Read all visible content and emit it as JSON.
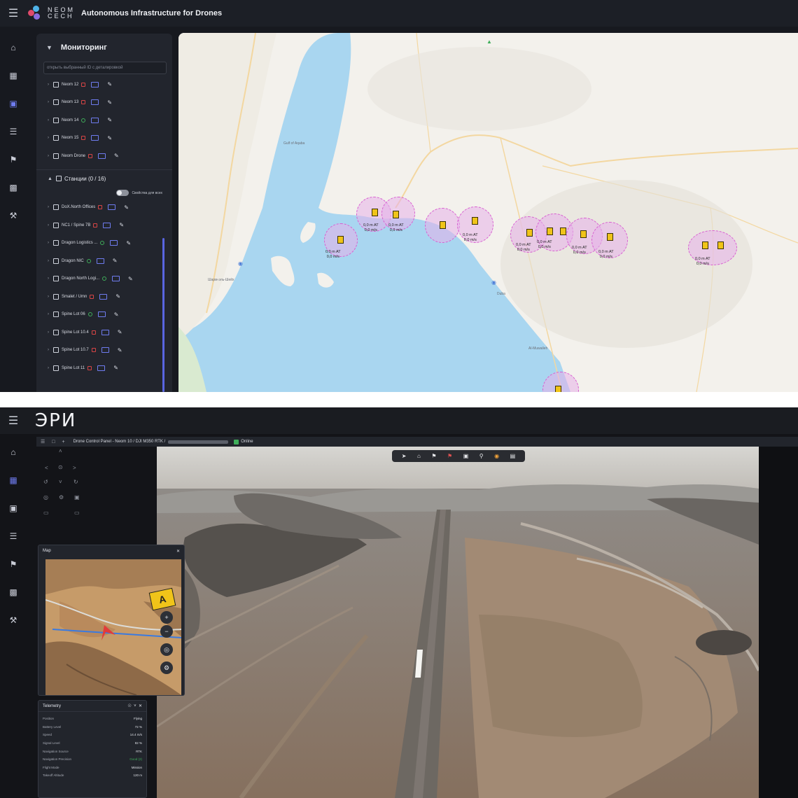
{
  "screen1": {
    "header": {
      "logo_text": "NEOM CECH",
      "app_title": "Autonomous Infrastructure for Drones"
    },
    "rail_icons": [
      "home-icon",
      "grid-icon",
      "monitor-icon",
      "list-icon",
      "flag-icon",
      "camera-icon",
      "wrench-icon"
    ],
    "rail_active": "monitor-icon",
    "panel": {
      "title": "Мониторинг",
      "search_placeholder": "открыть выбранный ID с деталировкой",
      "drones": [
        {
          "name": "Neom 12",
          "signal": "red"
        },
        {
          "name": "Neom 13",
          "signal": "red"
        },
        {
          "name": "Neom 14",
          "signal": "green"
        },
        {
          "name": "Neom 15",
          "signal": "red"
        },
        {
          "name": "Neom Drone",
          "signal": "red"
        }
      ],
      "stations_group": "Станции (0 / 16)",
      "toggle_label": "Свойства для всех",
      "stations": [
        {
          "name": "DoX.North Offices",
          "signal": "red"
        },
        {
          "name": "NC1 / Spine 7B",
          "signal": "red"
        },
        {
          "name": "Dragon Logistics ...",
          "signal": "green"
        },
        {
          "name": "Dragon NIC",
          "signal": "green"
        },
        {
          "name": "Dragon North Logi...",
          "signal": "green"
        },
        {
          "name": "Smalet / Umn",
          "signal": "red"
        },
        {
          "name": "Spine Lot 06",
          "signal": "green"
        },
        {
          "name": "Spine Lot 10.4",
          "signal": "red"
        },
        {
          "name": "Spine Lot 10.7",
          "signal": "red"
        },
        {
          "name": "Spine Lot 11",
          "signal": "red"
        }
      ]
    },
    "map": {
      "place_labels": [
        "Шарм-эль-Шейх",
        "Gulf of Aqaba",
        "Al-Muwaileh",
        "Duba"
      ],
      "station_labels": [
        {
          "l1": "0,0 m AT",
          "l2": "0,0 m/s"
        },
        {
          "l1": "0,0 m AT",
          "l2": "0,0 m/s"
        },
        {
          "l1": "0,0 m AT",
          "l2": "0,0 m/s"
        },
        {
          "l1": "0,0 m AT",
          "l2": "0,0 m/s"
        },
        {
          "l1": "0,0 m AT",
          "l2": "0,0 m/s"
        },
        {
          "l1": "0,0 m AT",
          "l2": "0,0 m/s"
        },
        {
          "l1": "0,0 m AT",
          "l2": "0,0 m/s"
        },
        {
          "l1": "0,0 m AT",
          "l2": "0,0 m/s"
        },
        {
          "l1": "0,0 m AT",
          "l2": "0,0 m/s"
        }
      ]
    }
  },
  "screen2": {
    "header": {
      "logo": "ЭРИ"
    },
    "rail_icons": [
      "home-icon",
      "grid-icon",
      "monitor-icon",
      "list-icon",
      "flag-icon",
      "camera-icon",
      "wrench-icon"
    ],
    "rail_active": "grid-icon",
    "subbar": {
      "crumb": "Drone Control Panel - Neom 10 / DJI M350 RTK /",
      "status": "Online"
    },
    "video_toolbar_icons": [
      "takeoff-icon",
      "home-icon",
      "flag-icon",
      "flag-alert-icon",
      "car-icon",
      "location-icon",
      "gps-icon",
      "screen-icon"
    ],
    "map_window": {
      "title": "Map",
      "marker_label": "A"
    },
    "telemetry": {
      "title": "Telemetry",
      "rows": [
        {
          "label": "Position",
          "value": "Flying"
        },
        {
          "label": "Battery Level",
          "value": "72 %"
        },
        {
          "label": "Speed",
          "value": "14.4 m/s"
        },
        {
          "label": "Signal Level",
          "value": "82 %"
        },
        {
          "label": "Navigation Source",
          "value": "RTK"
        },
        {
          "label": "Navigation Precision",
          "value": "Good (2)"
        },
        {
          "label": "Flight Mode",
          "value": "Mission"
        },
        {
          "label": "Takeoff Altitude",
          "value": "120 m"
        }
      ]
    },
    "colors": {
      "accent": "#6f7cf0",
      "online": "#3fae5a",
      "alert": "#d64545"
    }
  }
}
